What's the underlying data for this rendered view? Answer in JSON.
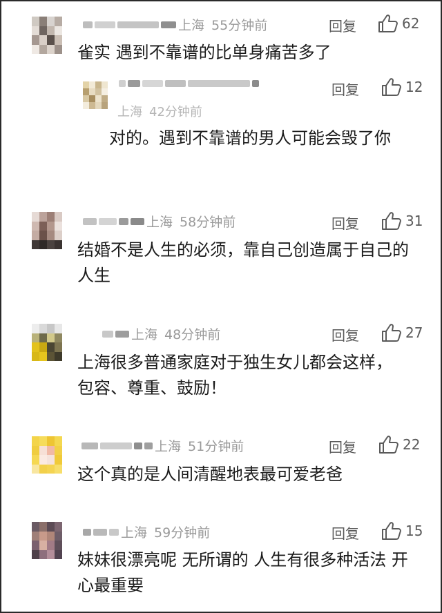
{
  "reply_label": "回复",
  "comments": [
    {
      "location": "上海",
      "time": "55分钟前",
      "likes": "62",
      "text": "雀实 遇到不靠谱的比单身痛苦多了"
    },
    {
      "location": "上海",
      "time": "42分钟前",
      "likes": "12",
      "text": "对的。遇到不靠谱的男人可能会毁了你"
    },
    {
      "location": "上海",
      "time": "58分钟前",
      "likes": "31",
      "text": "结婚不是人生的必须，靠自己创造属于自己的人生"
    },
    {
      "location": "上海",
      "time": "48分钟前",
      "likes": "27",
      "text": "上海很多普通家庭对于独生女儿都会这样，包容、尊重、鼓励！"
    },
    {
      "location": "上海",
      "time": "51分钟前",
      "likes": "22",
      "text": "这个真的是人间清醒地表最可爱老爸"
    },
    {
      "location": "上海",
      "time": "59分钟前",
      "likes": "15",
      "text": "妹妹很漂亮呢 无所谓的 人生有很多种活法 开心最重要"
    }
  ],
  "icons": {
    "like": "thumbs-up-icon",
    "avatar": "avatar"
  },
  "colors": {
    "meta": "#9a9a9a",
    "text": "#1b1b1b",
    "border": "#2a2a2a"
  }
}
